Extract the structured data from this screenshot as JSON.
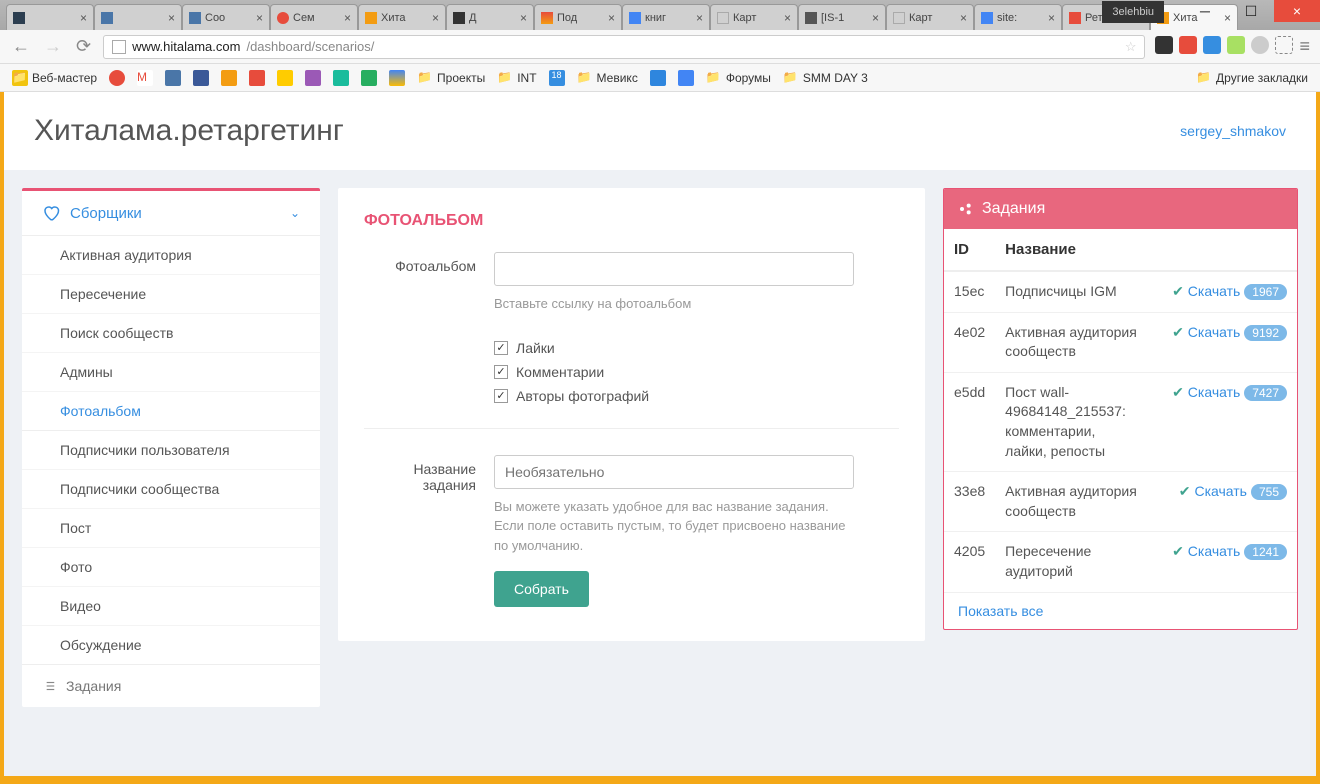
{
  "browser": {
    "tabs": [
      {
        "title": ""
      },
      {
        "title": ""
      },
      {
        "title": "Соо"
      },
      {
        "title": "Сем"
      },
      {
        "title": "Хита"
      },
      {
        "title": "Д"
      },
      {
        "title": "Под"
      },
      {
        "title": "книг"
      },
      {
        "title": "Карт"
      },
      {
        "title": "[IS-1"
      },
      {
        "title": "Карт"
      },
      {
        "title": "site:"
      },
      {
        "title": "Рета"
      },
      {
        "title": "Хита"
      }
    ],
    "user": "3elehbiu",
    "url_host": "www.hitalama.com",
    "url_path": "/dashboard/scenarios/",
    "bookmarks": [
      {
        "label": "Веб-мастер"
      },
      {
        "label": ""
      },
      {
        "label": ""
      },
      {
        "label": ""
      },
      {
        "label": ""
      },
      {
        "label": ""
      },
      {
        "label": ""
      },
      {
        "label": ""
      },
      {
        "label": ""
      },
      {
        "label": ""
      },
      {
        "label": ""
      },
      {
        "label": ""
      },
      {
        "label": "Проекты"
      },
      {
        "label": "INT"
      },
      {
        "label": ""
      },
      {
        "label": "Мевикс"
      },
      {
        "label": ""
      },
      {
        "label": ""
      },
      {
        "label": "Форумы"
      },
      {
        "label": "SMM DAY 3"
      }
    ],
    "other_bookmarks": "Другие закладки"
  },
  "app": {
    "brand": "Хиталама.ретаргетинг",
    "user": "sergey_shmakov"
  },
  "sidebar": {
    "collectors_label": "Сборщики",
    "group1": [
      "Активная аудитория",
      "Пересечение",
      "Поиск сообществ",
      "Админы",
      "Фотоальбом"
    ],
    "group2": [
      "Подписчики пользователя",
      "Подписчики сообщества",
      "Пост",
      "Фото",
      "Видео",
      "Обсуждение"
    ],
    "tasks_label": "Задания"
  },
  "form": {
    "panel_title": "ФОТОАЛЬБОМ",
    "album_label": "Фотоальбом",
    "album_hint": "Вставьте ссылку на фотоальбом",
    "chk_likes": "Лайки",
    "chk_comments": "Комментарии",
    "chk_authors": "Авторы фотографий",
    "task_name_label": "Название задания",
    "task_name_placeholder": "Необязательно",
    "task_name_hint": "Вы можете указать удобное для вас название задания. Если поле оставить пустым, то будет присвоено название по умолчанию.",
    "submit": "Собрать"
  },
  "tasks": {
    "header": "Задания",
    "th_id": "ID",
    "th_name": "Название",
    "download": "Скачать",
    "show_all": "Показать все",
    "rows": [
      {
        "id": "15ec",
        "name": "Подписчицы IGM",
        "count": "1967"
      },
      {
        "id": "4e02",
        "name": "Активная аудитория сообществ",
        "count": "9192"
      },
      {
        "id": "e5dd",
        "name": "Пост wall-49684148_215537: комментарии, лайки, репосты",
        "count": "7427"
      },
      {
        "id": "33e8",
        "name": "Активная аудитория сообществ",
        "count": "755"
      },
      {
        "id": "4205",
        "name": "Пересечение аудиторий",
        "count": "1241"
      }
    ]
  }
}
